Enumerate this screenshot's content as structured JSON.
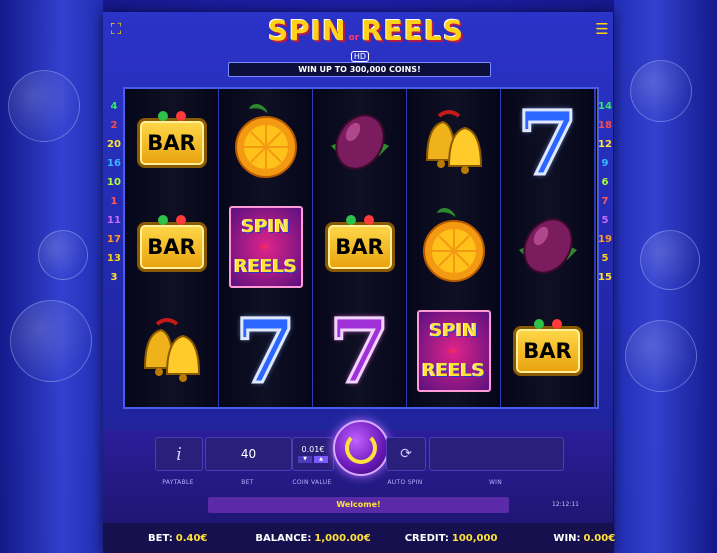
{
  "logo": {
    "word1": "SPIN",
    "or": "or",
    "word2": "REELS",
    "hd": "HD"
  },
  "banner": "WIN UP TO 300,000 COINS!",
  "paylines_left": [
    "4",
    "2",
    "20",
    "16",
    "10",
    "1",
    "11",
    "17",
    "13",
    "3"
  ],
  "paylines_right": [
    "14",
    "18",
    "12",
    "9",
    "6",
    "7",
    "5",
    "19",
    "5",
    "15"
  ],
  "reels": [
    [
      "BAR",
      "BAR",
      "bell"
    ],
    [
      "orange",
      "spin-reels",
      "seven-blue"
    ],
    [
      "plum",
      "BAR",
      "seven-purple"
    ],
    [
      "bell",
      "orange",
      "spin-reels"
    ],
    [
      "seven-blue",
      "plum",
      "BAR"
    ]
  ],
  "symbol_text": {
    "bar": "BAR",
    "spin": "SPIN",
    "or": "or",
    "reels": "REELS",
    "seven": "7"
  },
  "controls": {
    "paytable_label": "PAYTABLE",
    "paytable_icon": "i",
    "bet_value": "40",
    "bet_label": "BET",
    "coin_value": "0.01€",
    "coin_label": "COIN VALUE",
    "autospin_label": "AUTO SPIN",
    "win_label": "WIN"
  },
  "message": "Welcome!",
  "clock": "12:12:11",
  "status": {
    "bet_label": "BET:",
    "bet": "0.40€",
    "balance_label": "BALANCE:",
    "balance": "1,000.00€",
    "credit_label": "CREDIT:",
    "credit": "100,000",
    "win_label": "WIN:",
    "win": "0.00€"
  },
  "colors": {
    "accent": "#ffd21a",
    "panel": "#2a1f7a",
    "frame": "#2b33c8"
  }
}
